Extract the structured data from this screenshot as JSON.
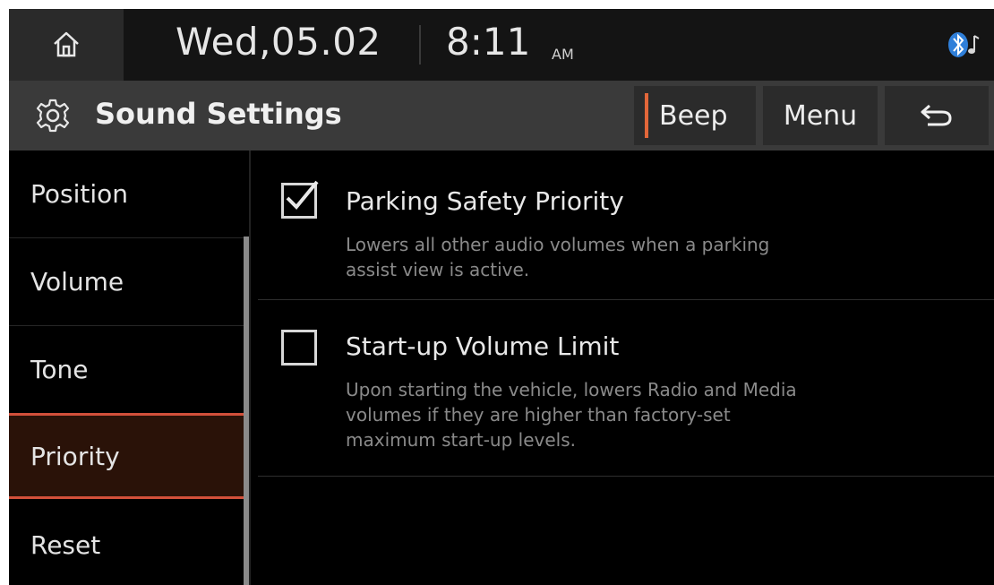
{
  "status": {
    "date": "Wed,05.02",
    "time": "8:11",
    "ampm": "AM",
    "home_icon": "home-icon",
    "bluetooth_icon": "bluetooth-audio-icon"
  },
  "header": {
    "title": "Sound Settings",
    "gear_icon": "gear-icon",
    "beep_label": "Beep",
    "menu_label": "Menu",
    "back_icon": "back-arrow-icon",
    "accent_color": "#e2673a"
  },
  "sidebar": {
    "items": [
      {
        "label": "Position",
        "active": false
      },
      {
        "label": "Volume",
        "active": false
      },
      {
        "label": "Tone",
        "active": false
      },
      {
        "label": "Priority",
        "active": true
      },
      {
        "label": "Reset",
        "active": false
      }
    ]
  },
  "options": [
    {
      "title": "Parking Safety Priority",
      "checked": true,
      "desc_lines": [
        "Lowers all other audio volumes when a parking",
        "assist view is active."
      ]
    },
    {
      "title": "Start-up Volume Limit",
      "checked": false,
      "desc_lines": [
        "Upon starting the vehicle, lowers Radio and Media",
        "volumes if they are higher than factory-set",
        "maximum start-up levels."
      ]
    }
  ]
}
